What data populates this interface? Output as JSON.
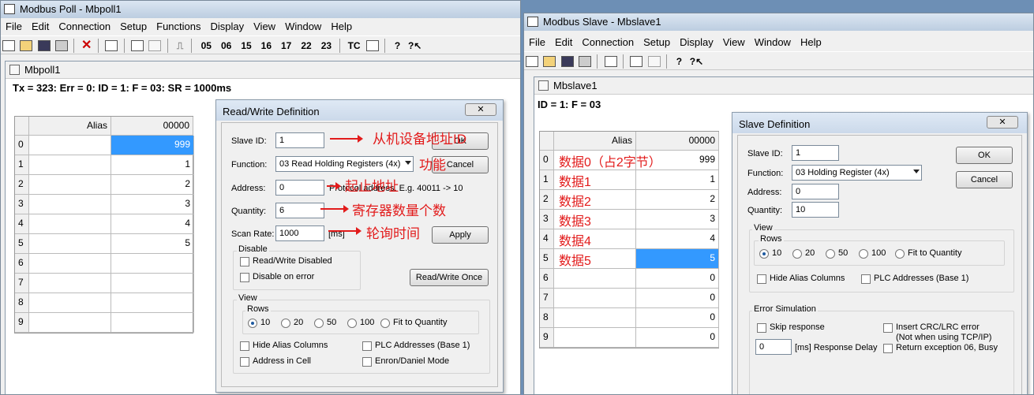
{
  "poll": {
    "title": "Modbus Poll - Mbpoll1",
    "menu": [
      "File",
      "Edit",
      "Connection",
      "Setup",
      "Functions",
      "Display",
      "View",
      "Window",
      "Help"
    ],
    "func_codes": [
      "05",
      "06",
      "15",
      "16",
      "17",
      "22",
      "23",
      "TC"
    ],
    "doc_title": "Mbpoll1",
    "status": "Tx = 323: Err = 0: ID = 1: F = 03: SR = 1000ms",
    "alias_header": "Alias",
    "addr_header": "00000",
    "rows": [
      "0",
      "1",
      "2",
      "3",
      "4",
      "5",
      "6",
      "7",
      "8",
      "9"
    ],
    "values": [
      "999",
      "1",
      "2",
      "3",
      "4",
      "5",
      "",
      "",
      "",
      ""
    ]
  },
  "rw_dialog": {
    "title": "Read/Write Definition",
    "close": "✕",
    "slave_id_label": "Slave ID:",
    "slave_id": "1",
    "function_label": "Function:",
    "function": "03 Read Holding Registers (4x)",
    "address_label": "Address:",
    "address": "0",
    "address_hint": "Protocol address. E.g. 40011 -> 10",
    "quantity_label": "Quantity:",
    "quantity": "6",
    "scan_label": "Scan Rate:",
    "scan": "1000",
    "scan_unit": "[ms]",
    "ok": "OK",
    "cancel": "Cancel",
    "apply": "Apply",
    "disable_group": "Disable",
    "rw_disabled": "Read/Write Disabled",
    "disable_on_error": "Disable on error",
    "rw_once": "Read/Write Once",
    "view_group": "View",
    "rows_group": "Rows",
    "row_opts": [
      "10",
      "20",
      "50",
      "100",
      "Fit to Quantity"
    ],
    "hide_alias": "Hide Alias Columns",
    "plc_addr": "PLC Addresses (Base 1)",
    "addr_in_cell": "Address in Cell",
    "enron": "Enron/Daniel Mode"
  },
  "annotations": {
    "slave_id": "从机设备地址ID",
    "function": "功能",
    "address": "起止地址",
    "quantity": "寄存器数量个数",
    "scan": "轮询时间"
  },
  "slave": {
    "title": "Modbus Slave - Mbslave1",
    "menu": [
      "File",
      "Edit",
      "Connection",
      "Setup",
      "Display",
      "View",
      "Window",
      "Help"
    ],
    "doc_title": "Mbslave1",
    "status": "ID = 1: F = 03",
    "alias_header": "Alias",
    "addr_header": "00000",
    "rows": [
      "0",
      "1",
      "2",
      "3",
      "4",
      "5",
      "6",
      "7",
      "8",
      "9"
    ],
    "aliases": [
      "数据0（占2字节）",
      "数据1",
      "数据2",
      "数据3",
      "数据4",
      "数据5",
      "",
      "",
      "",
      ""
    ],
    "values": [
      "999",
      "1",
      "2",
      "3",
      "4",
      "5",
      "0",
      "0",
      "0",
      "0"
    ]
  },
  "slave_dialog": {
    "title": "Slave Definition",
    "close": "✕",
    "slave_id_label": "Slave ID:",
    "slave_id": "1",
    "function_label": "Function:",
    "function": "03 Holding Register (4x)",
    "address_label": "Address:",
    "address": "0",
    "quantity_label": "Quantity:",
    "quantity": "10",
    "ok": "OK",
    "cancel": "Cancel",
    "view_group": "View",
    "rows_group": "Rows",
    "row_opts": [
      "10",
      "20",
      "50",
      "100",
      "Fit to Quantity"
    ],
    "hide_alias": "Hide Alias Columns",
    "plc_addr": "PLC Addresses (Base 1)",
    "error_group": "Error Simulation",
    "skip_response": "Skip response",
    "insert_crc": "Insert CRC/LRC error",
    "insert_crc_note": "(Not when using TCP/IP)",
    "delay": "0",
    "delay_label": "[ms] Response Delay",
    "return_exc": "Return exception 06, Busy"
  }
}
